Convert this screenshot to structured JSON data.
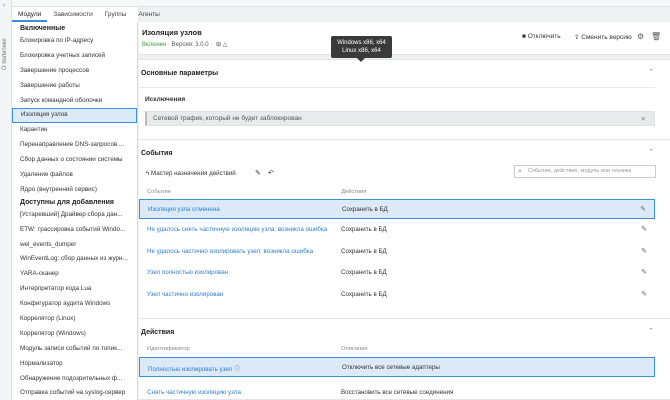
{
  "side_strip": {
    "label": "О политике",
    "chevron": "‹"
  },
  "tabs": [
    {
      "label": "Модули"
    },
    {
      "label": "Зависимости"
    },
    {
      "label": "Группы"
    },
    {
      "label": "Агенты"
    }
  ],
  "left_panel": {
    "enabled_header": "Включенные",
    "enabled_items": [
      "Блокировка по IP-адресу",
      "Блокировка учетных записей",
      "Завершение процессов",
      "Завершение работы",
      "Запуск командной оболочки",
      "Изоляция узлов",
      "Карантин",
      "Перенаправление DNS-запросов ...",
      "Сбор данных о состоянии системы",
      "Удаление файлов",
      "Ядро (внутренний сервис)"
    ],
    "selected_item": "Изоляция узлов",
    "available_header": "Доступны для добавления",
    "available_items": [
      "[Устаревший] Драйвер сбора дан...",
      "ETW: трассировка событий Windo...",
      "wel_events_dumper",
      "WinEventLog: сбор данных из журн...",
      "YARA-сканер",
      "Интерпретатор кода Lua",
      "Конфигуратор аудита Windows",
      "Коррелятор (Linux)",
      "Коррелятор (Windows)",
      "Модуль записи событий по топик...",
      "Нормализатор",
      "Обнаружение подозрительных ф...",
      "Отправка событий на syslog-сервер",
      "Отправка файлов"
    ]
  },
  "header": {
    "title": "Изоляция узлов",
    "status": "Включен",
    "version_label": "· Версия: 3.0.0 ·",
    "disable_label": "Отключить",
    "change_version_label": "Сменить версию",
    "tooltip_line1": "Windows x86, x64",
    "tooltip_line2": "Linux x86, x64"
  },
  "basic_params": {
    "title": "Основные параметры",
    "exceptions_label": "Исключения",
    "exception_value": "Сетевой трафик, который не будет заблокирован"
  },
  "events": {
    "title": "События",
    "wizard_label": "Мастер назначения действий",
    "search_placeholder": "Событие, действие, модуль или техника",
    "col_event": "Событие",
    "col_action": "Действия",
    "rows": [
      {
        "event": "Изоляция узла отменена",
        "action": "Сохранить в БД"
      },
      {
        "event": "Не удалось снять частичную изоляцию узла: возникла ошибка",
        "action": "Сохранить в БД"
      },
      {
        "event": "Не удалось частично изолировать узел: возникла ошибка",
        "action": "Сохранить в БД"
      },
      {
        "event": "Узел полностью изолирован",
        "action": "Сохранить в БД"
      },
      {
        "event": "Узел частично изолирован",
        "action": "Сохранить в БД"
      }
    ]
  },
  "actions": {
    "title": "Действия",
    "col_id": "Идентификатор",
    "col_desc": "Описание",
    "rows": [
      {
        "id": "Полностью изолировать узел",
        "desc": "Отключить все сетевые адаптеры"
      },
      {
        "id": "Снять частичную изоляцию узла",
        "desc": "Восстановить все сетевые соединения"
      }
    ]
  }
}
